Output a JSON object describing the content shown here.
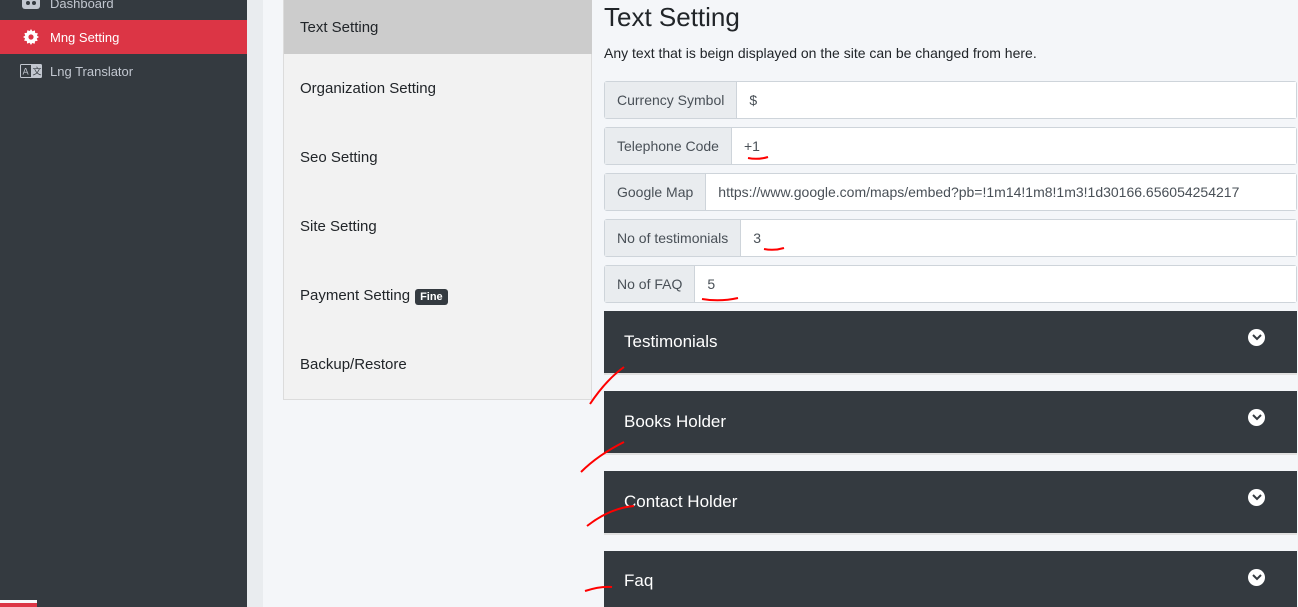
{
  "sidebar": {
    "items": [
      {
        "label": "Dashboard",
        "icon": "dashboard-icon"
      },
      {
        "label": "Mng Setting",
        "icon": "gear-icon",
        "active": true
      },
      {
        "label": "Lng Translator",
        "icon": "translate-icon"
      }
    ]
  },
  "settings_nav": {
    "items": [
      {
        "label": "Text Setting",
        "active": true
      },
      {
        "label": "Organization Setting"
      },
      {
        "label": "Seo Setting"
      },
      {
        "label": "Site Setting"
      },
      {
        "label": "Payment Setting",
        "badge": "Fine"
      },
      {
        "label": "Backup/Restore"
      }
    ]
  },
  "main": {
    "title": "Text Setting",
    "description": "Any text that is beign displayed on the site can be changed from here.",
    "fields": [
      {
        "label": "Currency Symbol",
        "value": "$"
      },
      {
        "label": "Telephone Code",
        "value": "+1"
      },
      {
        "label": "Google Map",
        "value": "https://www.google.com/maps/embed?pb=!1m14!1m8!1m3!1d30166.656054254217"
      },
      {
        "label": "No of testimonials",
        "value": "3"
      },
      {
        "label": "No of FAQ",
        "value": "5"
      }
    ],
    "accordions": [
      {
        "label": "Testimonials"
      },
      {
        "label": "Books Holder"
      },
      {
        "label": "Contact Holder"
      },
      {
        "label": "Faq"
      }
    ]
  },
  "colors": {
    "sidebar_bg": "#343a40",
    "active_red": "#dc3545",
    "annotation_red": "#ff0000"
  }
}
